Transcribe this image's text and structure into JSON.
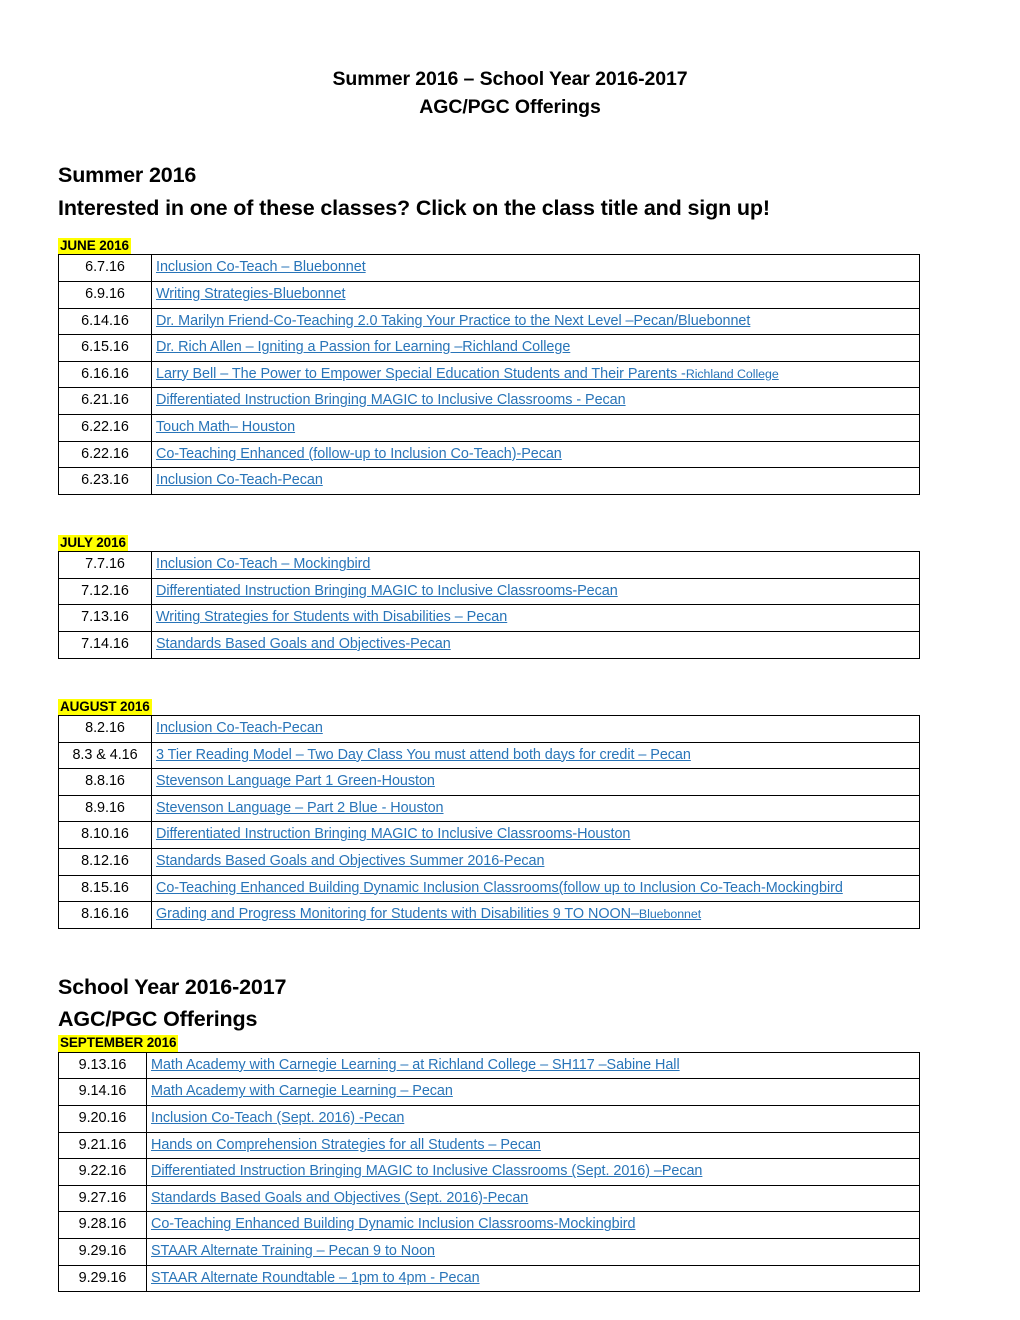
{
  "document": {
    "title_line1": "Summer 2016 – School Year 2016-2017",
    "title_line2": "AGC/PGC Offerings",
    "summer_heading": "Summer 2016",
    "summer_subheading": "Interested in one of these classes? Click on the class title and sign up!",
    "schoolyear_heading": "School Year 2016-2017",
    "schoolyear_subheading": "AGC/PGC Offerings"
  },
  "colors": {
    "link": "#2874B8",
    "highlight": "#FFFF00",
    "text": "#000000",
    "border": "#000000"
  },
  "sections": [
    {
      "month_label": "JUNE 2016",
      "rows": [
        {
          "date": "6.7.16",
          "title": "Inclusion Co-Teach – Bluebonnet"
        },
        {
          "date": "6.9.16",
          "title": "Writing Strategies-Bluebonnet"
        },
        {
          "date": "6.14.16",
          "title": "Dr. Marilyn Friend-Co-Teaching 2.0 Taking Your Practice to the Next Level –Pecan/Bluebonnet"
        },
        {
          "date": "6.15.16",
          "title": "Dr. Rich Allen – Igniting a Passion for Learning –Richland College"
        },
        {
          "date": "6.16.16",
          "title": "Larry Bell – The Power to Empower Special Education Students and Their Parents -",
          "title_small": "Richland College"
        },
        {
          "date": "6.21.16",
          "title": "Differentiated Instruction Bringing MAGIC to Inclusive Classrooms - Pecan"
        },
        {
          "date": "6.22.16",
          "title": "Touch Math– Houston"
        },
        {
          "date": "6.22.16",
          "title": "Co-Teaching Enhanced (follow-up to Inclusion Co-Teach)-Pecan"
        },
        {
          "date": "6.23.16",
          "title": "Inclusion Co-Teach-Pecan"
        }
      ]
    },
    {
      "month_label": "JULY 2016",
      "rows": [
        {
          "date": "7.7.16",
          "title": "Inclusion Co-Teach – Mockingbird"
        },
        {
          "date": "7.12.16",
          "title": "Differentiated Instruction Bringing MAGIC to Inclusive Classrooms-Pecan"
        },
        {
          "date": "7.13.16",
          "title": "Writing Strategies for Students with Disabilities – Pecan"
        },
        {
          "date": "7.14.16",
          "title": "Standards Based Goals and Objectives-Pecan"
        }
      ]
    },
    {
      "month_label": "AUGUST 2016",
      "rows": [
        {
          "date": "8.2.16",
          "title": "Inclusion Co-Teach-Pecan"
        },
        {
          "date": "8.3 & 4.16",
          "title": "3 Tier Reading Model – Two Day Class You must attend both days for credit – Pecan"
        },
        {
          "date": "8.8.16",
          "title": "Stevenson Language Part 1 Green-Houston"
        },
        {
          "date": "8.9.16",
          "title": "Stevenson Language – Part 2 Blue - Houston"
        },
        {
          "date": "8.10.16",
          "title": "Differentiated Instruction Bringing MAGIC to Inclusive Classrooms-Houston"
        },
        {
          "date": "8.12.16",
          "title": "Standards Based Goals and Objectives Summer 2016-Pecan"
        },
        {
          "date": "8.15.16",
          "title": "Co-Teaching Enhanced Building Dynamic Inclusion Classrooms(follow up to Inclusion Co-Teach-Mockingbird"
        },
        {
          "date": "8.16.16",
          "title": "Grading and Progress Monitoring for Students with Disabilities 9 TO NOON–",
          "title_small": "Bluebonnet"
        }
      ]
    },
    {
      "month_label": "SEPTEMBER 2016",
      "rows": [
        {
          "date": "9.13.16",
          "title": "Math Academy with Carnegie Learning – at Richland College – SH117 –Sabine Hall"
        },
        {
          "date": "9.14.16",
          "title": "Math Academy with Carnegie Learning – Pecan"
        },
        {
          "date": "9.20.16",
          "title": "Inclusion Co-Teach (Sept. 2016) -Pecan"
        },
        {
          "date": "9.21.16",
          "title": "Hands on Comprehension Strategies for all Students – Pecan"
        },
        {
          "date": "9.22.16",
          "title": "Differentiated Instruction Bringing MAGIC to Inclusive Classrooms (Sept. 2016) –Pecan"
        },
        {
          "date": "9.27.16",
          "title": "Standards Based Goals and Objectives (Sept. 2016)-Pecan"
        },
        {
          "date": "9.28.16",
          "title": "Co-Teaching Enhanced Building Dynamic Inclusion Classrooms-Mockingbird"
        },
        {
          "date": "9.29.16",
          "title": "STAAR Alternate Training – Pecan 9 to Noon"
        },
        {
          "date": "9.29.16",
          "title": "STAAR Alternate Roundtable – 1pm to 4pm - Pecan"
        }
      ]
    }
  ]
}
